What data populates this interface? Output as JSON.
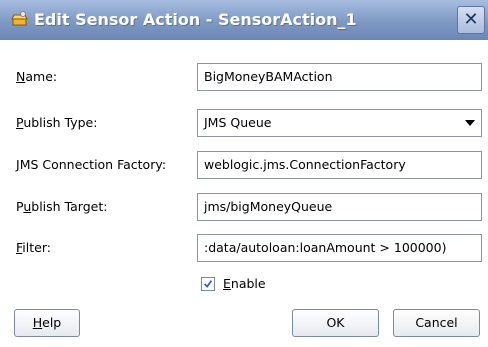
{
  "window": {
    "title": "Edit Sensor Action - SensorAction_1",
    "close_glyph": "✕"
  },
  "form": {
    "name": {
      "label_mnemonic": "N",
      "label_rest": "ame:",
      "value": "BigMoneyBAMAction"
    },
    "publish_type": {
      "label_mnemonic": "P",
      "label_rest": "ublish Type:",
      "value": "JMS Queue"
    },
    "jms_factory": {
      "label_mnemonic": "J",
      "label_rest": "MS Connection Factory:",
      "value": "weblogic.jms.ConnectionFactory"
    },
    "publish_target": {
      "label_pre": "P",
      "label_mnemonic": "u",
      "label_rest": "blish Target:",
      "value": "jms/bigMoneyQueue"
    },
    "filter": {
      "label_mnemonic": "F",
      "label_rest": "ilter:",
      "value": ":data/autoloan:loanAmount > 100000)"
    },
    "enable": {
      "label_mnemonic": "E",
      "label_rest": "nable",
      "checked": true
    }
  },
  "buttons": {
    "help": {
      "mnemonic": "H",
      "rest": "elp"
    },
    "ok": "OK",
    "cancel": "Cancel"
  },
  "colors": {
    "titlebar": "#7f99c4",
    "check": "#2a5fcf"
  }
}
